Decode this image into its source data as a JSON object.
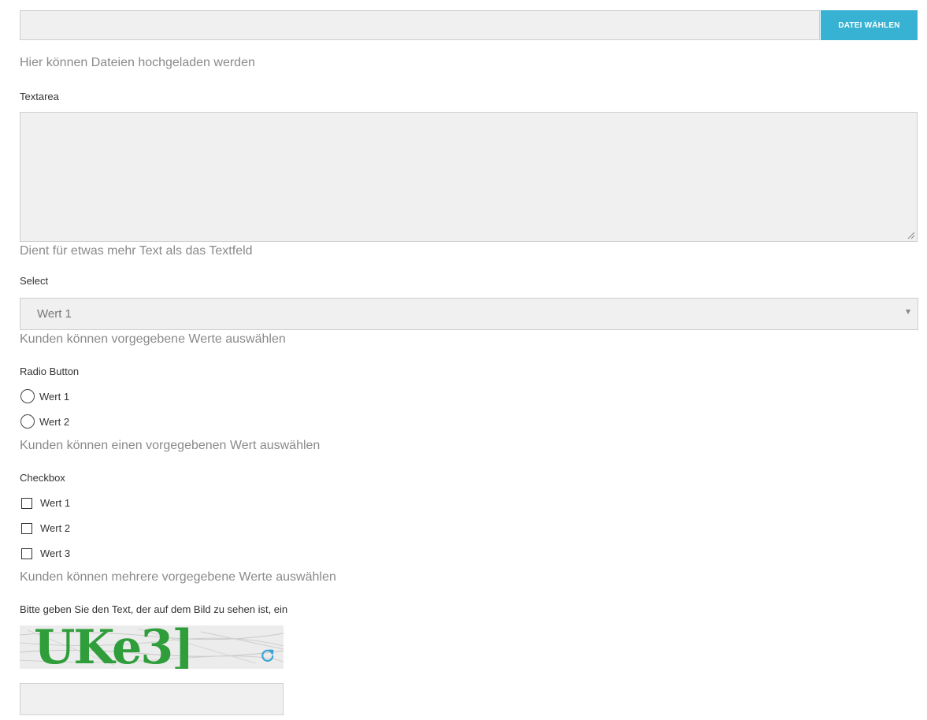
{
  "upload": {
    "button_label": "DATEI WÄHLEN",
    "help": "Hier können Dateien hochgeladen werden",
    "value": ""
  },
  "textarea": {
    "label": "Textarea",
    "help": "Dient für etwas mehr Text als das Textfeld",
    "value": ""
  },
  "select": {
    "label": "Select",
    "selected": "Wert 1",
    "help": "Kunden können vorgegebene Werte auswählen"
  },
  "radio": {
    "label": "Radio Button",
    "options": [
      "Wert 1",
      "Wert 2"
    ],
    "help": "Kunden können einen vorgegebenen Wert auswählen"
  },
  "checkbox": {
    "label": "Checkbox",
    "options": [
      "Wert 1",
      "Wert 2",
      "Wert 3"
    ],
    "help": "Kunden können mehrere vorgegebene Werte auswählen"
  },
  "captcha": {
    "label": "Bitte geben Sie den Text, der auf dem Bild zu sehen ist, ein",
    "image_text": "UKe3]",
    "text_color": "#2f9e3a",
    "value": ""
  },
  "colors": {
    "accent": "#38b2d3",
    "field_bg": "#f0f0f0"
  }
}
